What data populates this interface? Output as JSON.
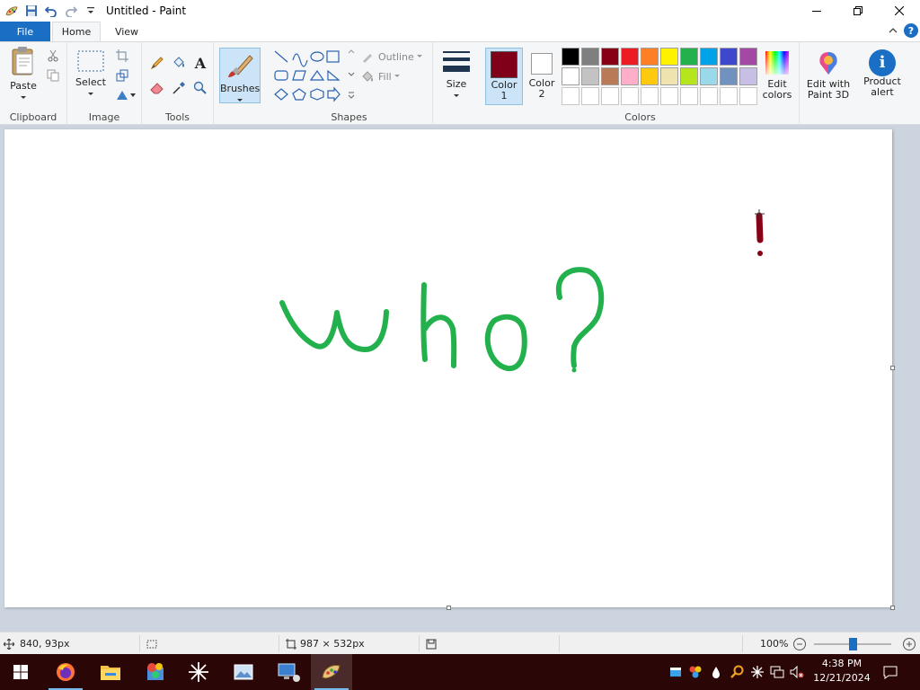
{
  "app": {
    "title": "Untitled - Paint"
  },
  "tabs": {
    "file": "File",
    "home": "Home",
    "view": "View",
    "help_glyph": "?"
  },
  "ribbon": {
    "clipboard": {
      "paste": "Paste",
      "group": "Clipboard"
    },
    "image": {
      "select": "Select",
      "group": "Image"
    },
    "tools": {
      "text_glyph": "A",
      "group": "Tools"
    },
    "brushes": {
      "label": "Brushes"
    },
    "shapes": {
      "outline": "Outline",
      "fill": "Fill",
      "group": "Shapes"
    },
    "size": {
      "label": "Size"
    },
    "colors": {
      "color1": "Color",
      "color1_num": "1",
      "color2": "Color",
      "color2_num": "2",
      "group": "Colors",
      "edit": "Edit",
      "edit2": "colors",
      "color1_value": "#7f0018",
      "color2_value": "#ffffff",
      "palette_row1": [
        "#000000",
        "#7f7f7f",
        "#880015",
        "#ed1c24",
        "#ff7f27",
        "#fff200",
        "#22b14c",
        "#00a2e8",
        "#3f48cc",
        "#a349a4"
      ],
      "palette_row2": [
        "#ffffff",
        "#c3c3c3",
        "#b97a57",
        "#ffaec9",
        "#ffc90e",
        "#efe4b0",
        "#b5e61d",
        "#99d9ea",
        "#7092be",
        "#c8bfe7"
      ]
    },
    "paint3d": {
      "line1": "Edit with",
      "line2": "Paint 3D"
    },
    "product_alert": {
      "line1": "Product",
      "line2": "alert",
      "glyph": "i"
    }
  },
  "canvas": {
    "text": "who?",
    "ink_color": "#22b14c",
    "mark_color": "#880015"
  },
  "status": {
    "cursor": "840, 93px",
    "size": "987 × 532px",
    "zoom": "100%",
    "zoom_level": 0.5
  },
  "taskbar": {
    "time": "4:38 PM",
    "date": "12/21/2024"
  }
}
